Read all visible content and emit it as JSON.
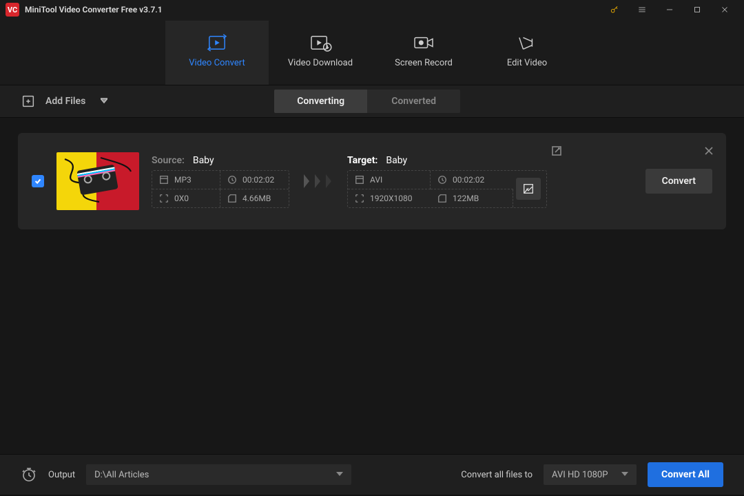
{
  "app": {
    "title": "MiniTool Video Converter Free v3.7.1"
  },
  "nav": {
    "tabs": [
      {
        "label": "Video Convert"
      },
      {
        "label": "Video Download"
      },
      {
        "label": "Screen Record"
      },
      {
        "label": "Edit Video"
      }
    ]
  },
  "toolbar": {
    "add_files": "Add Files",
    "seg": {
      "converting": "Converting",
      "converted": "Converted"
    }
  },
  "row": {
    "source_label": "Source:",
    "source_name": "Baby",
    "source": {
      "format": "MP3",
      "duration": "00:02:02",
      "resolution": "0X0",
      "size": "4.66MB"
    },
    "target_label": "Target:",
    "target_name": "Baby",
    "target": {
      "format": "AVI",
      "duration": "00:02:02",
      "resolution": "1920X1080",
      "size": "122MB"
    },
    "convert_btn": "Convert"
  },
  "footer": {
    "output_label": "Output",
    "output_path": "D:\\All Articles",
    "convert_all_label": "Convert all files to",
    "format_selected": "AVI HD 1080P",
    "convert_all_btn": "Convert All"
  }
}
